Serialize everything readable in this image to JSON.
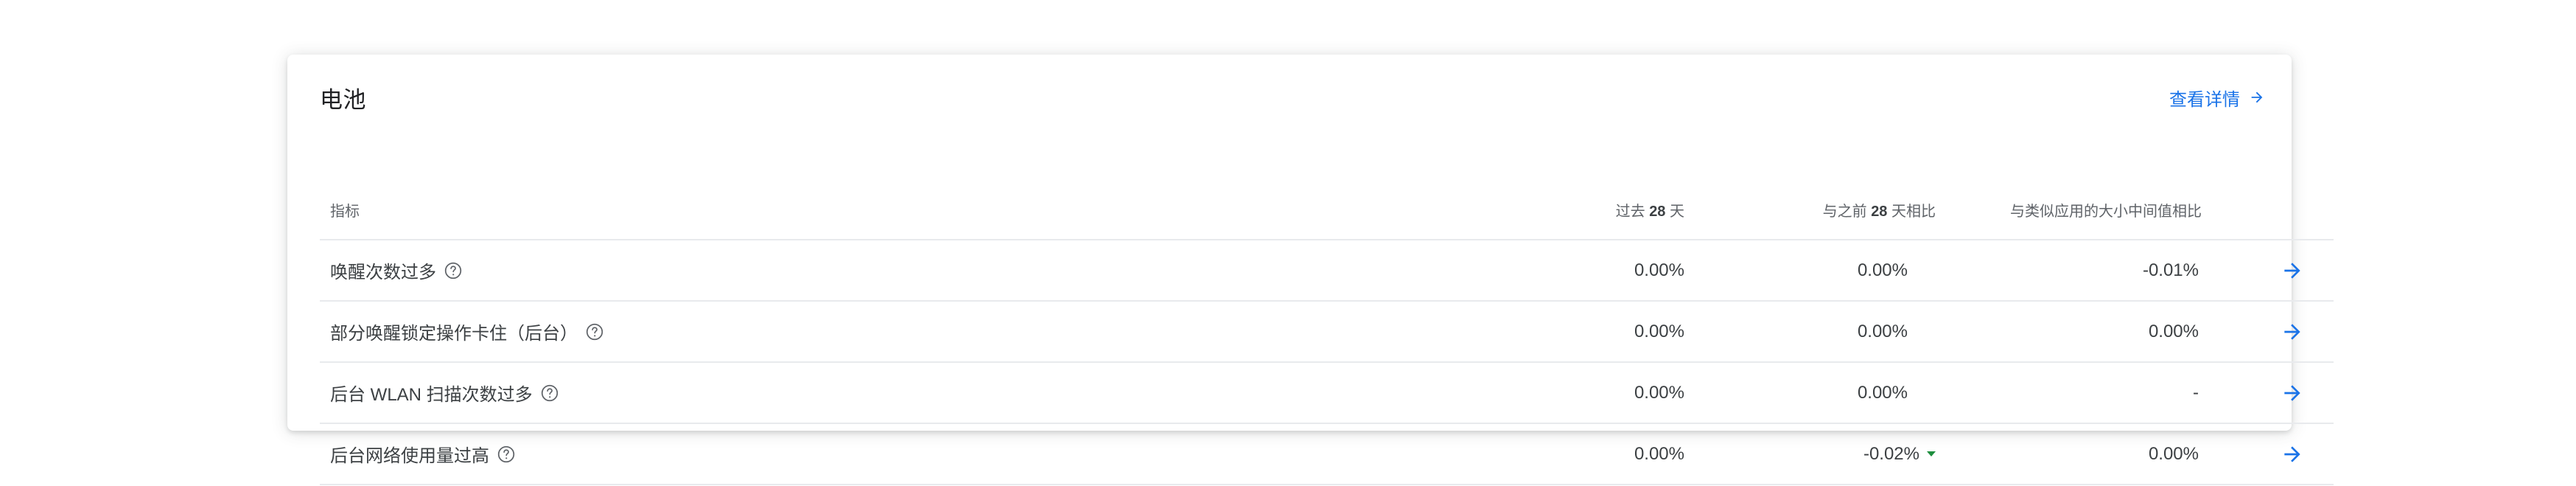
{
  "card": {
    "title": "电池",
    "details_link": "查看详情"
  },
  "table": {
    "headers": {
      "metric": "指标",
      "past_prefix": "过去",
      "past_bold": "28",
      "past_suffix": "天",
      "compare_prefix": "与之前",
      "compare_bold": "28",
      "compare_suffix": "天相比",
      "peers": "与类似应用的大小中间值相比"
    },
    "rows": [
      {
        "metric": "唤醒次数过多",
        "past": "0.00%",
        "compare": "0.00%",
        "peers": "-0.01%",
        "trend_down": false
      },
      {
        "metric": "部分唤醒锁定操作卡住（后台）",
        "past": "0.00%",
        "compare": "0.00%",
        "peers": "0.00%",
        "trend_down": false
      },
      {
        "metric": "后台 WLAN 扫描次数过多",
        "past": "0.00%",
        "compare": "0.00%",
        "peers": "-",
        "trend_down": false
      },
      {
        "metric": "后台网络使用量过高",
        "past": "0.00%",
        "compare": "-0.02%",
        "peers": "0.00%",
        "trend_down": true
      }
    ]
  },
  "colors": {
    "accent": "#1a73e8",
    "trend_down": "#1e8e3e"
  },
  "icons": {
    "help": "help-circle-icon",
    "arrow": "arrow-forward-icon",
    "trend": "triangle-down-icon"
  }
}
